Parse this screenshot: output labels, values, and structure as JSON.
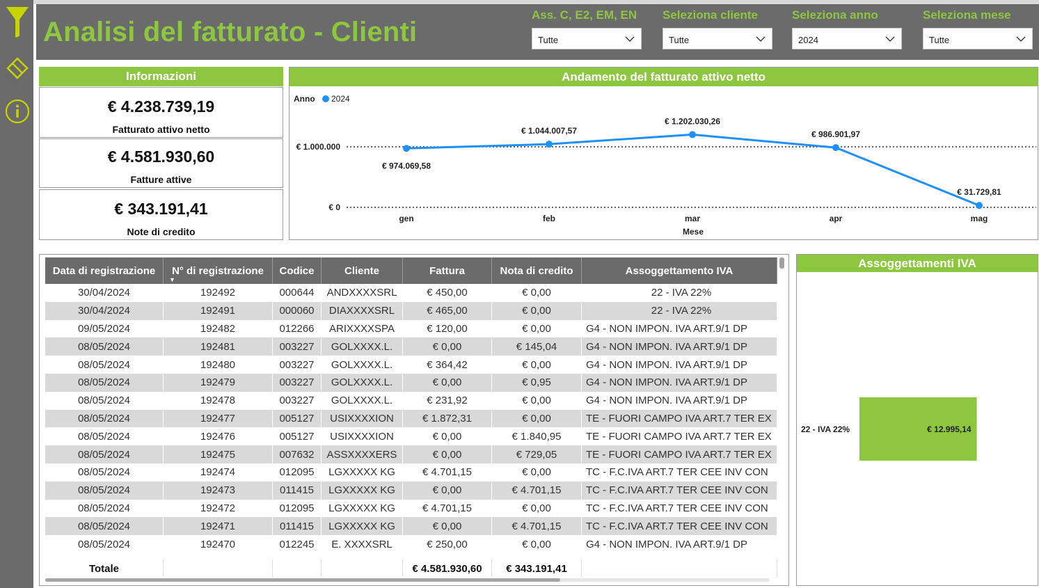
{
  "header": {
    "title": "Analisi del fatturato - Clienti",
    "filters": [
      {
        "label": "Ass. C, E2, EM, EN",
        "value": "Tutte"
      },
      {
        "label": "Seleziona cliente",
        "value": "Tutte"
      },
      {
        "label": "Seleziona anno",
        "value": "2024"
      },
      {
        "label": "Seleziona mese",
        "value": "Tutte"
      }
    ]
  },
  "rail": {
    "icons": [
      "filter-icon",
      "eraser-icon",
      "info-icon"
    ]
  },
  "info": {
    "title": "Informazioni",
    "kpis": [
      {
        "value": "€ 4.238.739,19",
        "label": "Fatturato attivo netto"
      },
      {
        "value": "€ 4.581.930,60",
        "label": "Fatture attive"
      },
      {
        "value": "€ 343.191,41",
        "label": "Note di credito"
      }
    ]
  },
  "trend": {
    "title": "Andamento del fatturato attivo netto",
    "legend_title": "Anno",
    "legend_series": "2024",
    "xlabel": "Mese",
    "yticks": [
      "€ 1.000.000",
      "€ 0"
    ],
    "point_labels": [
      "€ 974.069,58",
      "€ 1.044.007,57",
      "€ 1.202.030,26",
      "€ 986.901,97",
      "€ 31.729,81"
    ],
    "series_color": "#1e90ff"
  },
  "chart_data": [
    {
      "type": "line",
      "title": "Andamento del fatturato attivo netto",
      "xlabel": "Mese",
      "ylabel": "",
      "categories": [
        "gen",
        "feb",
        "mar",
        "apr",
        "mag"
      ],
      "series": [
        {
          "name": "2024",
          "values": [
            974069.58,
            1044007.57,
            1202030.26,
            986901.97,
            31729.81
          ]
        }
      ],
      "ylim": [
        0,
        1300000
      ],
      "yticks": [
        0,
        1000000
      ],
      "grid": false,
      "legend": "top-left"
    },
    {
      "type": "bar",
      "title": "Assoggettamenti IVA",
      "orientation": "horizontal",
      "categories": [
        "22 - IVA 22%"
      ],
      "values": [
        12995.14
      ],
      "value_labels": [
        "€ 12.995,14"
      ],
      "xlim": [
        0,
        18500
      ],
      "color": "#8dc63f"
    }
  ],
  "table": {
    "columns": [
      "Data di registrazione",
      "N° di registrazione",
      "Codice",
      "Cliente",
      "Fattura",
      "Nota di credito",
      "Assoggettamento IVA"
    ],
    "rows": [
      [
        "30/04/2024",
        "192492",
        "000644",
        "ANDXXXXSRL",
        "€ 450,00",
        "€ 0,00",
        "22 - IVA 22%"
      ],
      [
        "30/04/2024",
        "192491",
        "000060",
        "DIAXXXXSRL",
        "€ 465,00",
        "€ 0,00",
        "22 - IVA 22%"
      ],
      [
        "09/05/2024",
        "192482",
        "012266",
        "ARIXXXXSPA",
        "€ 120,00",
        "€ 0,00",
        "G4 - NON IMPON. IVA ART.9/1 DP"
      ],
      [
        "08/05/2024",
        "192481",
        "003227",
        "GOLXXXX.L.",
        "€ 0,00",
        "€ 145,04",
        "G4 - NON IMPON. IVA ART.9/1 DP"
      ],
      [
        "08/05/2024",
        "192480",
        "003227",
        "GOLXXXX.L.",
        "€ 364,42",
        "€ 0,00",
        "G4 - NON IMPON. IVA ART.9/1 DP"
      ],
      [
        "08/05/2024",
        "192479",
        "003227",
        "GOLXXXX.L.",
        "€ 0,00",
        "€ 0,95",
        "G4 - NON IMPON. IVA ART.9/1 DP"
      ],
      [
        "08/05/2024",
        "192478",
        "003227",
        "GOLXXXX.L.",
        "€ 231,92",
        "€ 0,00",
        "G4 - NON IMPON. IVA ART.9/1 DP"
      ],
      [
        "08/05/2024",
        "192477",
        "005127",
        "USIXXXXION",
        "€ 1.872,31",
        "€ 0,00",
        "TE - FUORI CAMPO IVA ART.7 TER EX"
      ],
      [
        "08/05/2024",
        "192476",
        "005127",
        "USIXXXXION",
        "€ 0,00",
        "€ 1.840,95",
        "TE - FUORI CAMPO IVA ART.7 TER EX"
      ],
      [
        "08/05/2024",
        "192475",
        "007632",
        "ASSXXXXERS",
        "€ 0,00",
        "€ 729,05",
        "TE - FUORI CAMPO IVA ART.7 TER EX"
      ],
      [
        "08/05/2024",
        "192474",
        "012095",
        "LGXXXXX KG",
        "€ 4.701,15",
        "€ 0,00",
        "TC - F.C.IVA ART.7 TER CEE INV CON"
      ],
      [
        "08/05/2024",
        "192473",
        "011415",
        "LGXXXXX KG",
        "€ 0,00",
        "€ 4.701,15",
        "TC - F.C.IVA ART.7 TER CEE INV CON"
      ],
      [
        "08/05/2024",
        "192472",
        "012095",
        "LGXXXXX KG",
        "€ 4.701,15",
        "€ 0,00",
        "TC - F.C.IVA ART.7 TER CEE INV CON"
      ],
      [
        "08/05/2024",
        "192471",
        "011415",
        "LGXXXXX KG",
        "€ 0,00",
        "€ 4.701,15",
        "TC - F.C.IVA ART.7 TER CEE INV CON"
      ],
      [
        "08/05/2024",
        "192470",
        "012245",
        "E. XXXXSRL",
        "€ 250,00",
        "€ 0,00",
        "G4 - NON IMPON. IVA ART.9/1 DP"
      ]
    ],
    "total": {
      "label": "Totale",
      "fattura": "€ 4.581.930,60",
      "nota": "€ 343.191,41"
    }
  },
  "iva_panel": {
    "title": "Assoggettamenti IVA",
    "category": "22 - IVA 22%",
    "value_label": "€ 12.995,14",
    "bar_color": "#8dc63f"
  }
}
